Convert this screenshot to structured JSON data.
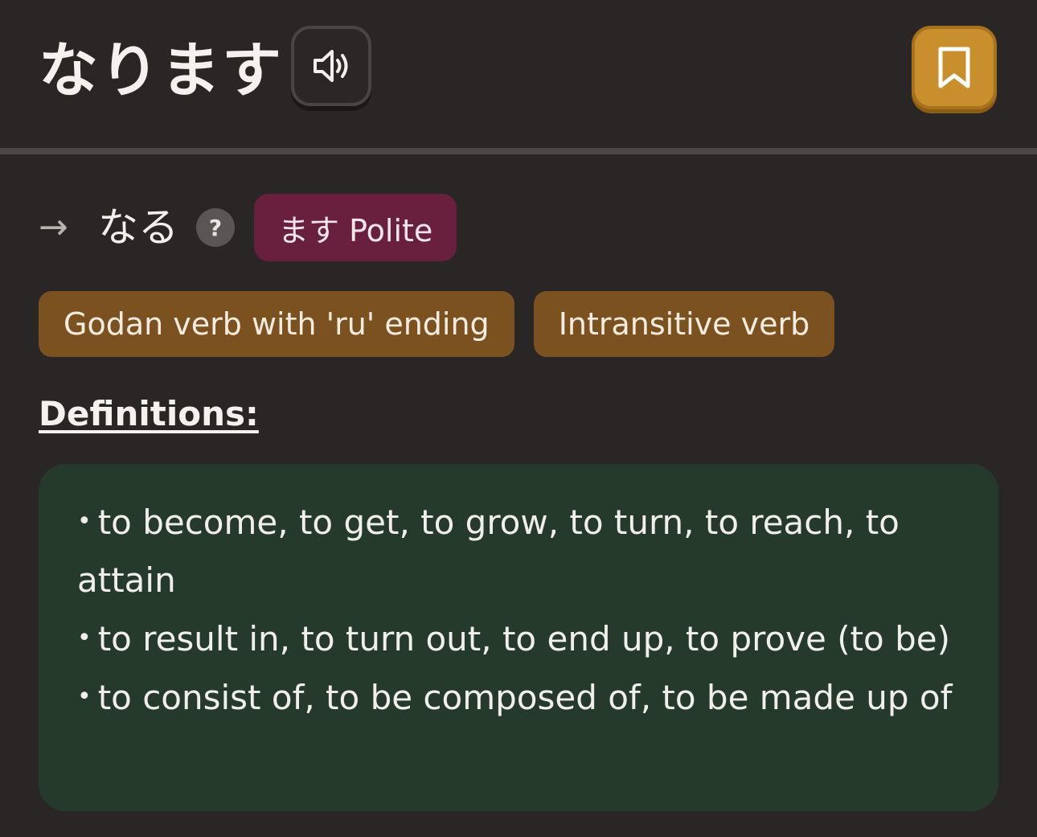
{
  "header": {
    "word": "なります",
    "audio_icon": "speaker-icon",
    "bookmark_icon": "bookmark-icon"
  },
  "base_form": {
    "arrow": "→",
    "word": "なる",
    "help_icon": "?",
    "polite_tag": "ます Polite"
  },
  "tags": [
    "Godan verb with 'ru' ending",
    "Intransitive verb"
  ],
  "definitions": {
    "heading": "Definitions:",
    "bullet": "•",
    "items": [
      "to become, to get, to grow, to turn, to reach, to attain",
      "to result in, to turn out, to end up, to prove (to be)",
      "to consist of, to be composed of, to be made up of"
    ]
  },
  "colors": {
    "background": "#2a2626",
    "bookmark": "#c98f2c",
    "polite_tag": "#68203e",
    "tag": "#7b521f",
    "definition_box": "#253a2b"
  }
}
